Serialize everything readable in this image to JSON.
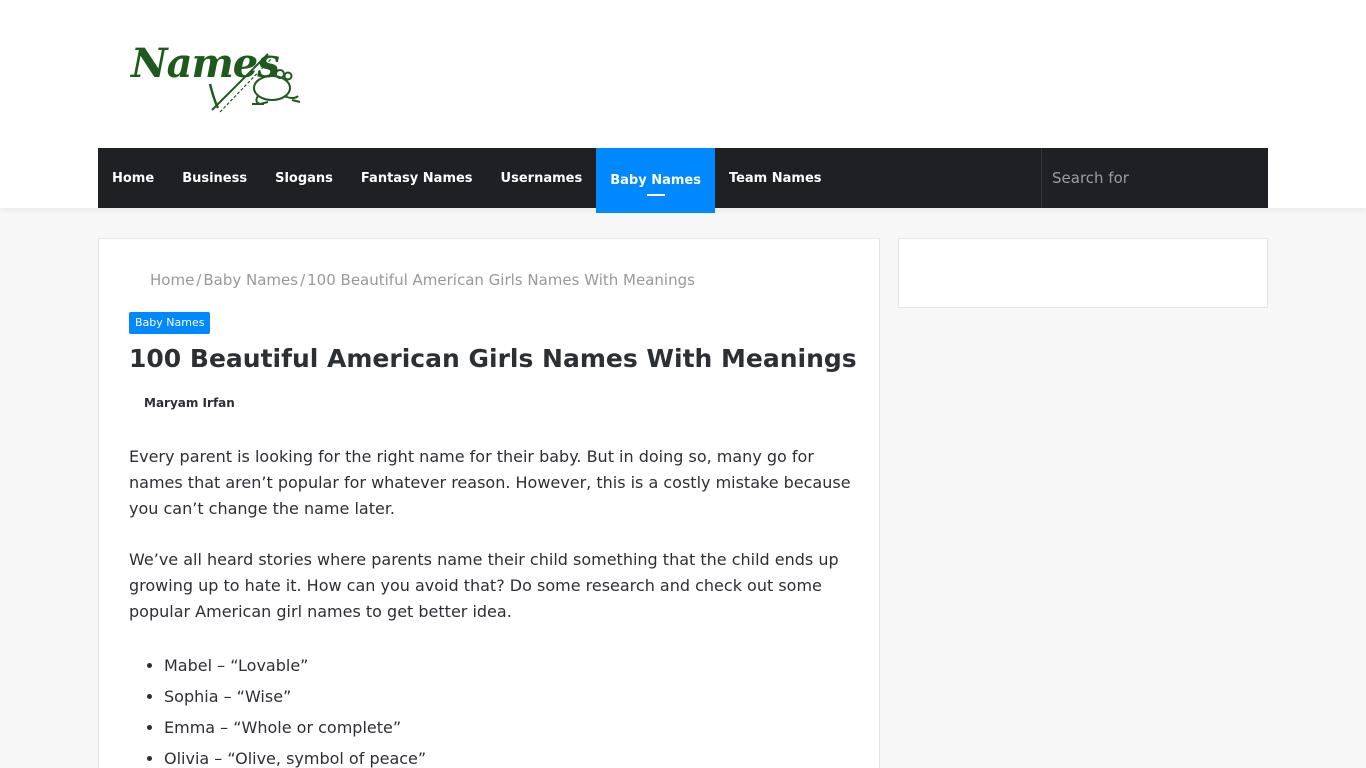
{
  "logo": {
    "text": "Names"
  },
  "nav": {
    "items": [
      {
        "label": "Home"
      },
      {
        "label": "Business"
      },
      {
        "label": "Slogans"
      },
      {
        "label": "Fantasy Names"
      },
      {
        "label": "Usernames"
      },
      {
        "label": "Baby Names",
        "active": true
      },
      {
        "label": "Team Names"
      }
    ],
    "search_placeholder": "Search for"
  },
  "breadcrumb": {
    "home": "Home",
    "category": "Baby Names",
    "current": "100 Beautiful American Girls Names With Meanings",
    "separator": "/"
  },
  "post": {
    "category_badge": "Baby Names",
    "title": "100 Beautiful American Girls Names With Meanings",
    "author": "Maryam Irfan",
    "paragraphs": [
      "Every parent is looking for the right name for their baby. But in doing so, many go for names that aren’t popular for whatever reason. However, this is a costly mistake because you can’t change the name later.",
      "We’ve all heard stories where parents name their child something that the child ends up growing up to hate it. How can you avoid that? Do some research and check out some popular American girl names to get better idea."
    ],
    "names_list": [
      "Mabel – “Lovable”",
      "Sophia – “Wise”",
      "Emma – “Whole or complete”",
      "Olivia – “Olive, symbol of peace”"
    ]
  },
  "colors": {
    "nav_bg": "#1f2024",
    "accent": "#0088ff",
    "logo_green": "#1e5a1e"
  }
}
